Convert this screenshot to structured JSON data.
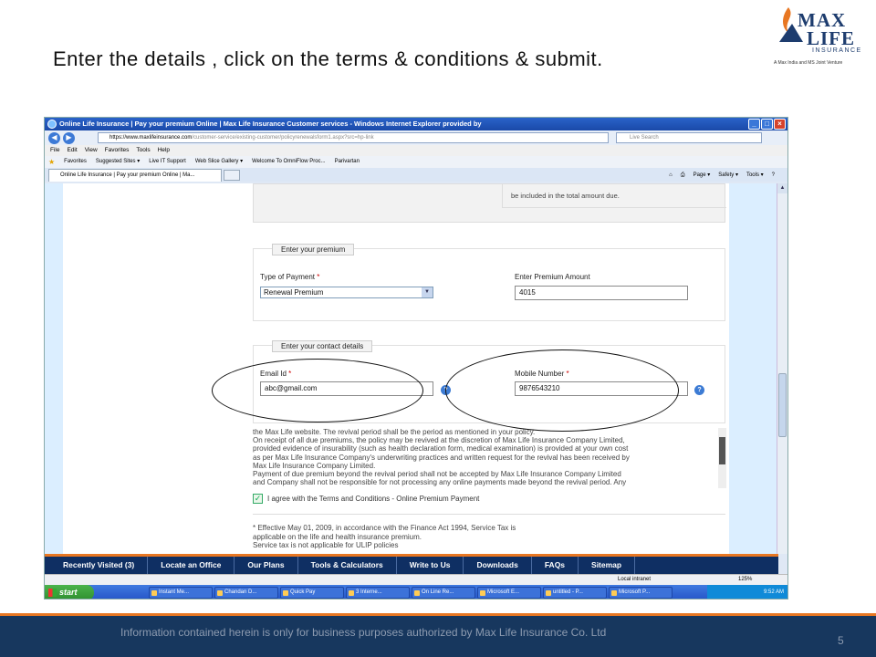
{
  "slide": {
    "title": "Enter the details , click on the terms & conditions  & submit.",
    "disclaimer": "Information contained herein is only for business purposes authorized by Max Life Insurance Co. Ltd",
    "page_number": "5"
  },
  "logo": {
    "line1": "MAX",
    "line2": "LIFE",
    "line3": "INSURANCE",
    "tagline": "A Max India and MS Joint Venture"
  },
  "browser": {
    "window_title": "Online Life Insurance | Pay your premium Online | Max Life Insurance Customer services - Windows Internet Explorer provided by",
    "address_domain": "https://www.maxlifeinsurance.com",
    "address_path": "/customer-service/existing-customer/policyrenewalsform1.aspx?src=hp-link",
    "search_placeholder": "Live Search",
    "menu": [
      "File",
      "Edit",
      "View",
      "Favorites",
      "Tools",
      "Help"
    ],
    "favorites": [
      "Favorites",
      "Suggested Sites ▾",
      "Live IT Support",
      "Web Slice Gallery ▾",
      "Welcome To OmniFlow Proc...",
      "Parivartan"
    ],
    "tab_label": "Online Life Insurance | Pay your premium Online | Ma...",
    "commands": [
      "Page ▾",
      "Safety ▾",
      "Tools ▾"
    ]
  },
  "form": {
    "top_note": "be included in the total amount due.",
    "premium_section": {
      "legend": "Enter your premium",
      "payment_type_label": "Type of Payment",
      "payment_type_value": "Renewal Premium",
      "amount_label": "Enter Premium Amount",
      "amount_value": "4015"
    },
    "contact_section": {
      "legend": "Enter your contact details",
      "email_label": "Email Id",
      "email_value": "abc@gmail.com",
      "mobile_label": "Mobile Number",
      "mobile_value": "9876543210"
    },
    "required_mark": "*",
    "terms_text": [
      "the Max Life website. The revival period shall be the period as mentioned in your policy.",
      "On receipt of all due premiums, the policy may be revived at the discretion of Max Life Insurance Company Limited,",
      "provided evidence of insurability (such as health declaration form, medical examination) is provided at your own cost",
      "as per Max Life Insurance Company's underwriting practices and written request for the revival has been received by",
      "Max Life Insurance Company Limited.",
      "Payment of due premium beyond the revival period shall not be accepted by Max Life Insurance Company Limited",
      "and Company shall not be responsible for not processing any online payments made beyond the revival period. Any"
    ],
    "agree_label": "I agree with the Terms and Conditions - Online Premium Payment",
    "tax_lines": [
      "* Effective May 01, 2009, in accordance with the Finance Act 1994, Service Tax is",
      "applicable on the life and health insurance premium.",
      "Service tax is not applicable for ULIP policies"
    ]
  },
  "footer_nav": [
    "Recently Visited (3)",
    "Locate an Office",
    "Our Plans",
    "Tools & Calculators",
    "Write to Us",
    "Downloads",
    "FAQs",
    "Sitemap"
  ],
  "statusbar": {
    "zone": "Local intranet",
    "zoom": "125%"
  },
  "taskbar": {
    "start": "start",
    "buttons": [
      "Instant Me...",
      "Chandan D...",
      "Quick Pay",
      "3 Interne...",
      "On Line Re...",
      "Microsoft E...",
      "untitled - P...",
      "Microsoft P..."
    ],
    "clock": "9:52 AM"
  },
  "colors": {
    "accent_orange": "#e87722",
    "brand_navy": "#17375e"
  }
}
